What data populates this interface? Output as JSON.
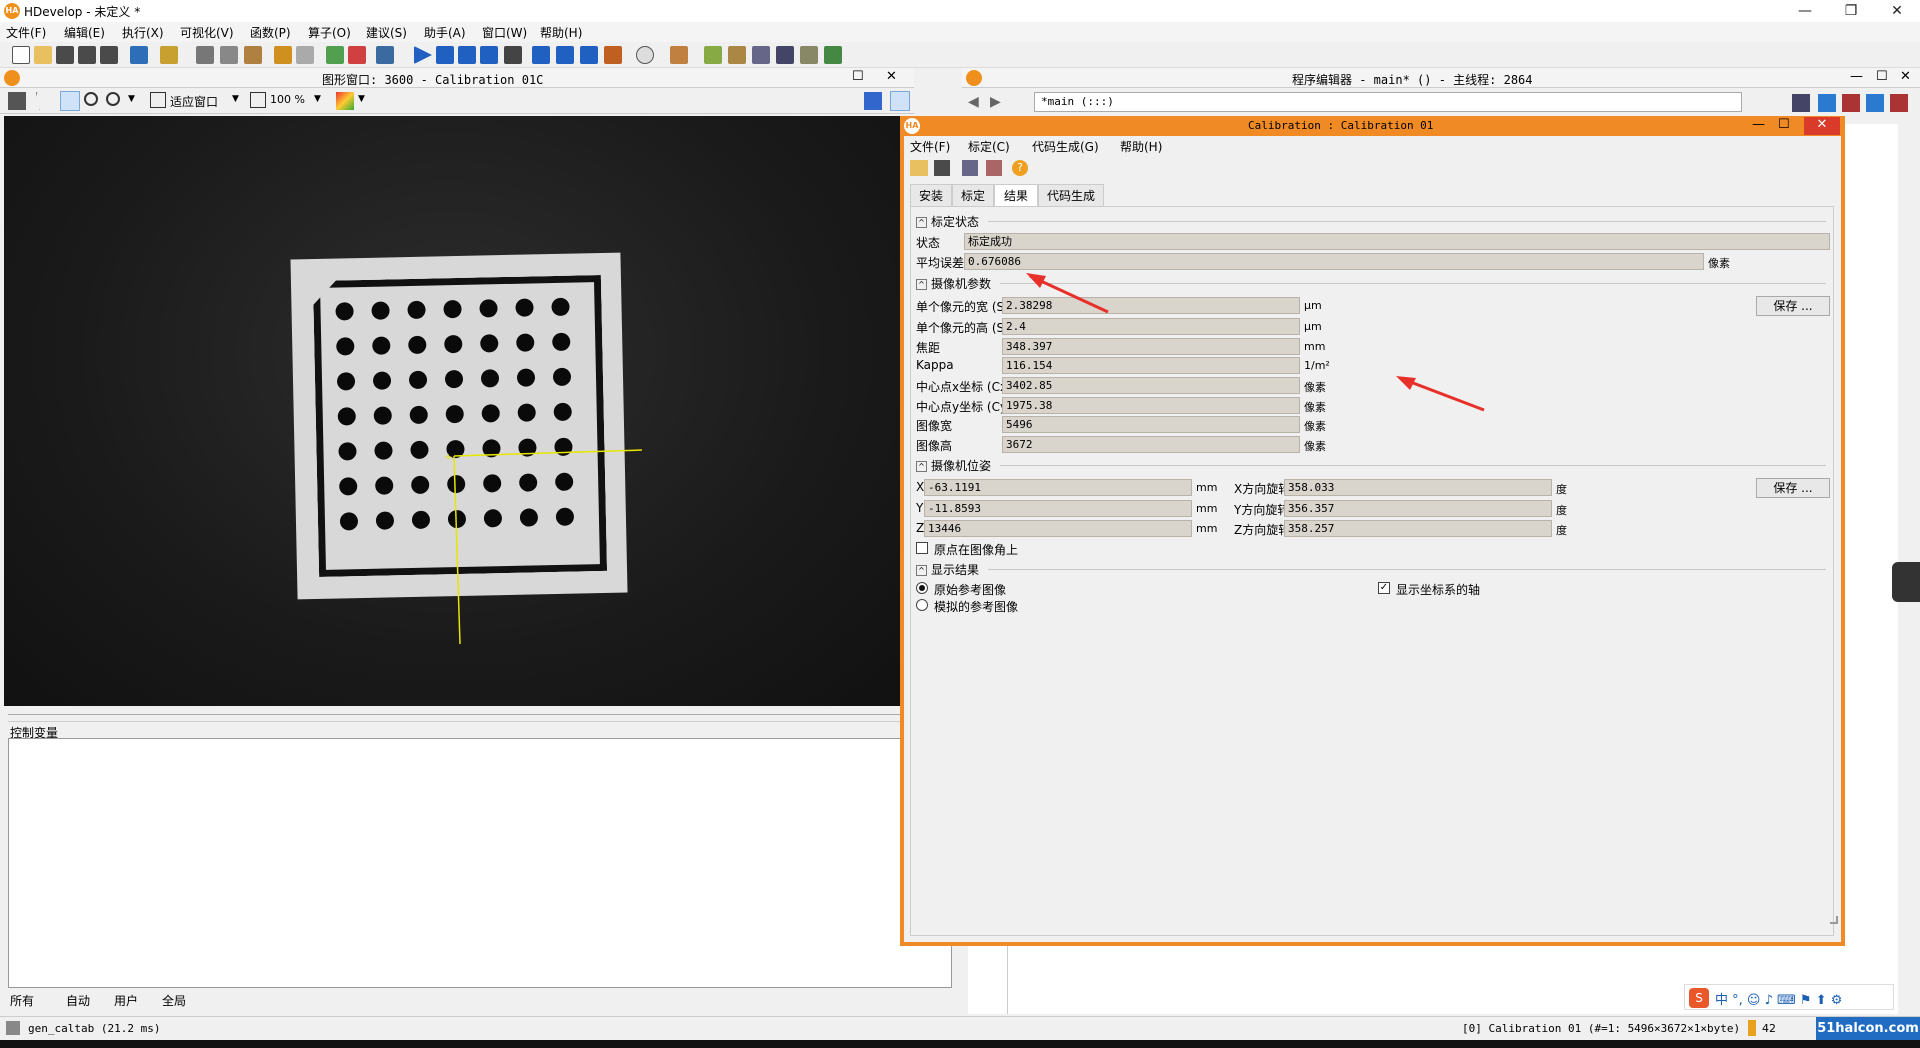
{
  "app": {
    "title": "HDevelop - 未定义 *",
    "logo": "HA",
    "win_controls": [
      "—",
      "❐",
      "✕"
    ]
  },
  "menu": [
    "文件(F)",
    "编辑(E)",
    "执行(X)",
    "可视化(V)",
    "函数(P)",
    "算子(O)",
    "建议(S)",
    "助手(A)",
    "窗口(W)",
    "帮助(H)"
  ],
  "graphics_window": {
    "title": "图形窗口: 3600 - Calibration 01C",
    "zoom_mode": "适应窗口",
    "zoom_percent": "100 %"
  },
  "program_editor": {
    "title": "程序编辑器 - main* () - 主线程: 2864",
    "procedure": "*main (:::)"
  },
  "dialog": {
    "title": "Calibration : Calibration 01",
    "menu": [
      "文件(F)",
      "标定(C)",
      "代码生成(G)",
      "帮助(H)"
    ],
    "tabs": [
      "安装",
      "标定",
      "结果",
      "代码生成"
    ],
    "active_tab": "结果",
    "calib_status": {
      "section": "标定状态",
      "status_label": "状态",
      "status_value": "标定成功",
      "mean_error_label": "平均误差",
      "mean_error_value": "0.676086",
      "mean_error_unit": "像素"
    },
    "camera_params": {
      "section": "摄像机参数",
      "save_button": "保存 ...",
      "rows": [
        {
          "label": "单个像元的宽 (Sx)",
          "value": "2.38298",
          "unit": "μm"
        },
        {
          "label": "单个像元的高 (Sy)",
          "value": "2.4",
          "unit": "μm"
        },
        {
          "label": "焦距",
          "value": "348.397",
          "unit": "mm"
        },
        {
          "label": "Kappa",
          "value": "116.154",
          "unit": "1/m²"
        },
        {
          "label": "中心点x坐标 (Cx)",
          "value": "3402.85",
          "unit": "像素"
        },
        {
          "label": "中心点y坐标 (Cy)",
          "value": "1975.38",
          "unit": "像素"
        },
        {
          "label": "图像宽",
          "value": "5496",
          "unit": "像素"
        },
        {
          "label": "图像高",
          "value": "3672",
          "unit": "像素"
        }
      ]
    },
    "camera_pose": {
      "section": "摄像机位姿",
      "save_button": "保存 ...",
      "translation": [
        {
          "label": "X",
          "value": "-63.1191",
          "unit": "mm"
        },
        {
          "label": "Y",
          "value": "-11.8593",
          "unit": "mm"
        },
        {
          "label": "Z",
          "value": "13446",
          "unit": "mm"
        }
      ],
      "rotation": [
        {
          "label": "X方向旋转",
          "value": "358.033",
          "unit": "度"
        },
        {
          "label": "Y方向旋转",
          "value": "356.357",
          "unit": "度"
        },
        {
          "label": "Z方向旋转",
          "value": "358.257",
          "unit": "度"
        }
      ],
      "origin_checkbox": "原点在图像角上"
    },
    "display": {
      "section": "显示结果",
      "radio_original": "原始参考图像",
      "radio_simulated": "模拟的参考图像",
      "show_axes": "显示坐标系的轴"
    }
  },
  "control_vars": {
    "title": "控制变量",
    "tabs": [
      "所有",
      "自动",
      "用户",
      "全局"
    ]
  },
  "status": {
    "left": "gen_caltab (21.2 ms)",
    "right": "[0] Calibration 01 (#=1: 5496×3672×1×byte)",
    "count": "42",
    "watermark": "51halcon.com"
  },
  "colors": {
    "accent": "#f08a24",
    "axis": "#e6e600",
    "arrow": "#e8302a"
  }
}
